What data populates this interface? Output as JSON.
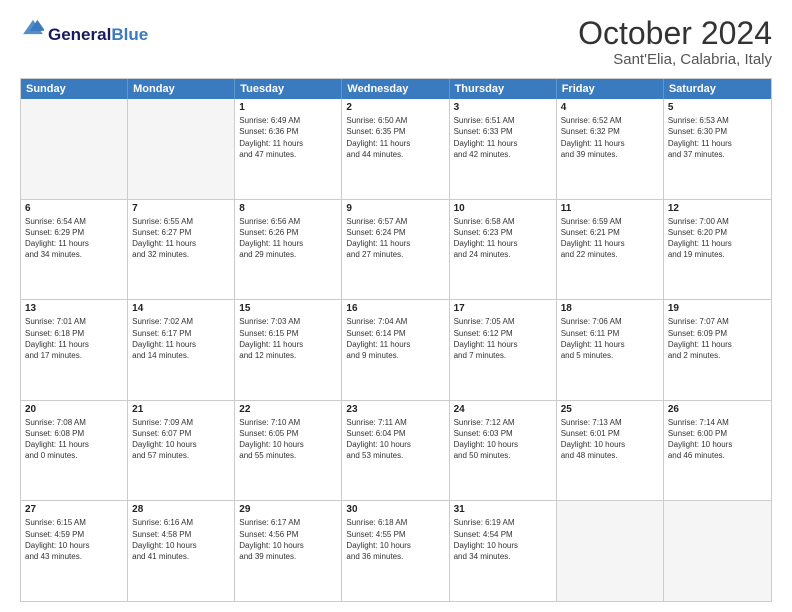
{
  "header": {
    "logo_general": "General",
    "logo_blue": "Blue",
    "month_title": "October 2024",
    "subtitle": "Sant'Elia, Calabria, Italy"
  },
  "days_of_week": [
    "Sunday",
    "Monday",
    "Tuesday",
    "Wednesday",
    "Thursday",
    "Friday",
    "Saturday"
  ],
  "weeks": [
    [
      {
        "day": "",
        "empty": true,
        "lines": []
      },
      {
        "day": "",
        "empty": true,
        "lines": []
      },
      {
        "day": "1",
        "empty": false,
        "lines": [
          "Sunrise: 6:49 AM",
          "Sunset: 6:36 PM",
          "Daylight: 11 hours",
          "and 47 minutes."
        ]
      },
      {
        "day": "2",
        "empty": false,
        "lines": [
          "Sunrise: 6:50 AM",
          "Sunset: 6:35 PM",
          "Daylight: 11 hours",
          "and 44 minutes."
        ]
      },
      {
        "day": "3",
        "empty": false,
        "lines": [
          "Sunrise: 6:51 AM",
          "Sunset: 6:33 PM",
          "Daylight: 11 hours",
          "and 42 minutes."
        ]
      },
      {
        "day": "4",
        "empty": false,
        "lines": [
          "Sunrise: 6:52 AM",
          "Sunset: 6:32 PM",
          "Daylight: 11 hours",
          "and 39 minutes."
        ]
      },
      {
        "day": "5",
        "empty": false,
        "lines": [
          "Sunrise: 6:53 AM",
          "Sunset: 6:30 PM",
          "Daylight: 11 hours",
          "and 37 minutes."
        ]
      }
    ],
    [
      {
        "day": "6",
        "empty": false,
        "lines": [
          "Sunrise: 6:54 AM",
          "Sunset: 6:29 PM",
          "Daylight: 11 hours",
          "and 34 minutes."
        ]
      },
      {
        "day": "7",
        "empty": false,
        "lines": [
          "Sunrise: 6:55 AM",
          "Sunset: 6:27 PM",
          "Daylight: 11 hours",
          "and 32 minutes."
        ]
      },
      {
        "day": "8",
        "empty": false,
        "lines": [
          "Sunrise: 6:56 AM",
          "Sunset: 6:26 PM",
          "Daylight: 11 hours",
          "and 29 minutes."
        ]
      },
      {
        "day": "9",
        "empty": false,
        "lines": [
          "Sunrise: 6:57 AM",
          "Sunset: 6:24 PM",
          "Daylight: 11 hours",
          "and 27 minutes."
        ]
      },
      {
        "day": "10",
        "empty": false,
        "lines": [
          "Sunrise: 6:58 AM",
          "Sunset: 6:23 PM",
          "Daylight: 11 hours",
          "and 24 minutes."
        ]
      },
      {
        "day": "11",
        "empty": false,
        "lines": [
          "Sunrise: 6:59 AM",
          "Sunset: 6:21 PM",
          "Daylight: 11 hours",
          "and 22 minutes."
        ]
      },
      {
        "day": "12",
        "empty": false,
        "lines": [
          "Sunrise: 7:00 AM",
          "Sunset: 6:20 PM",
          "Daylight: 11 hours",
          "and 19 minutes."
        ]
      }
    ],
    [
      {
        "day": "13",
        "empty": false,
        "lines": [
          "Sunrise: 7:01 AM",
          "Sunset: 6:18 PM",
          "Daylight: 11 hours",
          "and 17 minutes."
        ]
      },
      {
        "day": "14",
        "empty": false,
        "lines": [
          "Sunrise: 7:02 AM",
          "Sunset: 6:17 PM",
          "Daylight: 11 hours",
          "and 14 minutes."
        ]
      },
      {
        "day": "15",
        "empty": false,
        "lines": [
          "Sunrise: 7:03 AM",
          "Sunset: 6:15 PM",
          "Daylight: 11 hours",
          "and 12 minutes."
        ]
      },
      {
        "day": "16",
        "empty": false,
        "lines": [
          "Sunrise: 7:04 AM",
          "Sunset: 6:14 PM",
          "Daylight: 11 hours",
          "and 9 minutes."
        ]
      },
      {
        "day": "17",
        "empty": false,
        "lines": [
          "Sunrise: 7:05 AM",
          "Sunset: 6:12 PM",
          "Daylight: 11 hours",
          "and 7 minutes."
        ]
      },
      {
        "day": "18",
        "empty": false,
        "lines": [
          "Sunrise: 7:06 AM",
          "Sunset: 6:11 PM",
          "Daylight: 11 hours",
          "and 5 minutes."
        ]
      },
      {
        "day": "19",
        "empty": false,
        "lines": [
          "Sunrise: 7:07 AM",
          "Sunset: 6:09 PM",
          "Daylight: 11 hours",
          "and 2 minutes."
        ]
      }
    ],
    [
      {
        "day": "20",
        "empty": false,
        "lines": [
          "Sunrise: 7:08 AM",
          "Sunset: 6:08 PM",
          "Daylight: 11 hours",
          "and 0 minutes."
        ]
      },
      {
        "day": "21",
        "empty": false,
        "lines": [
          "Sunrise: 7:09 AM",
          "Sunset: 6:07 PM",
          "Daylight: 10 hours",
          "and 57 minutes."
        ]
      },
      {
        "day": "22",
        "empty": false,
        "lines": [
          "Sunrise: 7:10 AM",
          "Sunset: 6:05 PM",
          "Daylight: 10 hours",
          "and 55 minutes."
        ]
      },
      {
        "day": "23",
        "empty": false,
        "lines": [
          "Sunrise: 7:11 AM",
          "Sunset: 6:04 PM",
          "Daylight: 10 hours",
          "and 53 minutes."
        ]
      },
      {
        "day": "24",
        "empty": false,
        "lines": [
          "Sunrise: 7:12 AM",
          "Sunset: 6:03 PM",
          "Daylight: 10 hours",
          "and 50 minutes."
        ]
      },
      {
        "day": "25",
        "empty": false,
        "lines": [
          "Sunrise: 7:13 AM",
          "Sunset: 6:01 PM",
          "Daylight: 10 hours",
          "and 48 minutes."
        ]
      },
      {
        "day": "26",
        "empty": false,
        "lines": [
          "Sunrise: 7:14 AM",
          "Sunset: 6:00 PM",
          "Daylight: 10 hours",
          "and 46 minutes."
        ]
      }
    ],
    [
      {
        "day": "27",
        "empty": false,
        "lines": [
          "Sunrise: 6:15 AM",
          "Sunset: 4:59 PM",
          "Daylight: 10 hours",
          "and 43 minutes."
        ]
      },
      {
        "day": "28",
        "empty": false,
        "lines": [
          "Sunrise: 6:16 AM",
          "Sunset: 4:58 PM",
          "Daylight: 10 hours",
          "and 41 minutes."
        ]
      },
      {
        "day": "29",
        "empty": false,
        "lines": [
          "Sunrise: 6:17 AM",
          "Sunset: 4:56 PM",
          "Daylight: 10 hours",
          "and 39 minutes."
        ]
      },
      {
        "day": "30",
        "empty": false,
        "lines": [
          "Sunrise: 6:18 AM",
          "Sunset: 4:55 PM",
          "Daylight: 10 hours",
          "and 36 minutes."
        ]
      },
      {
        "day": "31",
        "empty": false,
        "lines": [
          "Sunrise: 6:19 AM",
          "Sunset: 4:54 PM",
          "Daylight: 10 hours",
          "and 34 minutes."
        ]
      },
      {
        "day": "",
        "empty": true,
        "lines": []
      },
      {
        "day": "",
        "empty": true,
        "lines": []
      }
    ]
  ]
}
